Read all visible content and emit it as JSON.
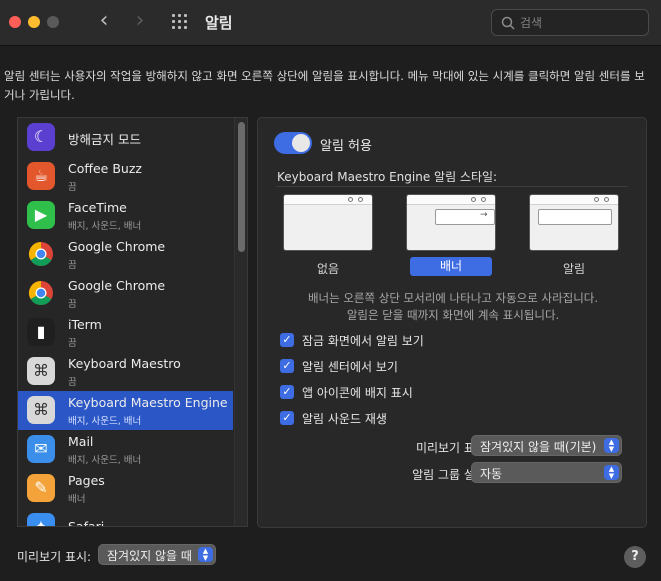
{
  "window": {
    "title": "알림"
  },
  "search": {
    "placeholder": "검색"
  },
  "description": "알림 센터는 사용자의 작업을 방해하지 않고 화면 오른쪽 상단에 알림을 표시합니다. 메뉴 막대에 있는 시계를 클릭하면 알림 센터를 보거나 가립니다.",
  "apps": [
    {
      "name": "방해금지 모드",
      "sub": "",
      "icon": "moon-icon",
      "color": "#5b3fd1"
    },
    {
      "name": "Coffee Buzz",
      "sub": "끔",
      "icon": "coffee-icon",
      "color": "#e2572b"
    },
    {
      "name": "FaceTime",
      "sub": "배지, 사운드, 배너",
      "icon": "facetime-icon",
      "color": "#2ec04a"
    },
    {
      "name": "Google Chrome",
      "sub": "끔",
      "icon": "chrome-icon",
      "color": "#ffffff"
    },
    {
      "name": "Google Chrome",
      "sub": "끔",
      "icon": "chrome-icon",
      "color": "#ffffff"
    },
    {
      "name": "iTerm",
      "sub": "끔",
      "icon": "iterm-icon",
      "color": "#1f1f1f"
    },
    {
      "name": "Keyboard Maestro",
      "sub": "끔",
      "icon": "keyboard-maestro-icon",
      "color": "#d8d8d8"
    },
    {
      "name": "Keyboard Maestro Engine",
      "sub": "배지, 사운드, 배너",
      "icon": "keyboard-maestro-icon",
      "color": "#d8d8d8"
    },
    {
      "name": "Mail",
      "sub": "배지, 사운드, 배너",
      "icon": "mail-icon",
      "color": "#3b8eea"
    },
    {
      "name": "Pages",
      "sub": "배너",
      "icon": "pages-icon",
      "color": "#f3a33a"
    },
    {
      "name": "Safari",
      "sub": "",
      "icon": "safari-icon",
      "color": "#3a8ef0"
    }
  ],
  "selected_app_index": 7,
  "detail": {
    "allow_label": "알림 허용",
    "style_title": "Keyboard Maestro Engine 알림 스타일:",
    "styles": [
      "없음",
      "배너",
      "알림"
    ],
    "selected_style": "배너",
    "style_desc_1": "배너는 오른쪽 상단 모서리에 나타나고 자동으로 사라집니다.",
    "style_desc_2": "알림은 닫을 때까지 화면에 계속 표시됩니다.",
    "checks": [
      "잠금 화면에서 알림 보기",
      "알림 센터에서 보기",
      "앱 아이콘에 배지 표시",
      "알림 사운드 재생"
    ],
    "preview_label": "미리보기 표시",
    "preview_value": "잠겨있지 않을 때(기본)",
    "group_label": "알림 그룹 설정",
    "group_value": "자동"
  },
  "bottom": {
    "preview_label": "미리보기 표시:",
    "preview_value": "잠겨있지 않을 때"
  },
  "colors": {
    "accent": "#3d6ce3",
    "selection": "#2a56c6"
  }
}
